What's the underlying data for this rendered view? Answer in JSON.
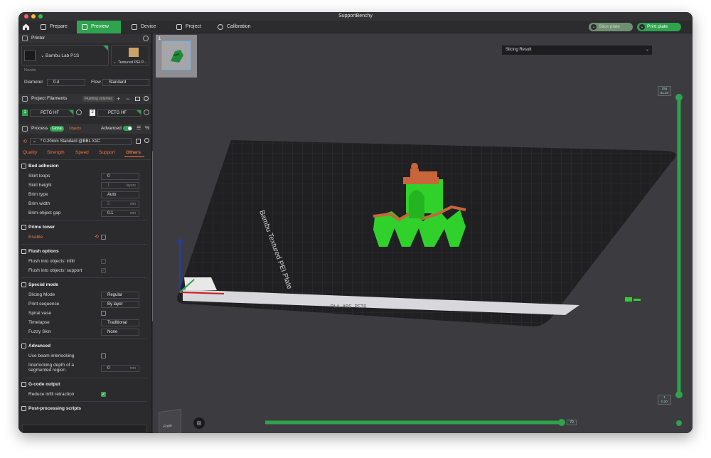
{
  "app": {
    "title": "SupportBenchy"
  },
  "colors": {
    "accent": "#2fa34e",
    "orange": "#e8763a",
    "model_green": "#2fd12a",
    "model_orange": "#c8653a"
  },
  "tabs": [
    {
      "label": "Prepare",
      "icon": "cube-icon"
    },
    {
      "label": "Preview",
      "icon": "layers-icon"
    },
    {
      "label": "Device",
      "icon": "device-icon"
    },
    {
      "label": "Project",
      "icon": "project-icon"
    },
    {
      "label": "Calibration",
      "icon": "calibration-icon"
    }
  ],
  "top_actions": {
    "slice": "Slice plate",
    "print": "Print plate"
  },
  "slicing_result": {
    "label": "Slicing Result"
  },
  "printer": {
    "header": "Printer",
    "name": "Bambu Lab P1S",
    "plate": "Textured PEI P...",
    "nozzle_label": "Nozzle",
    "diameter_label": "Diameter",
    "diameter_value": "0.4",
    "flow_label": "Flow",
    "flow_value": "Standard"
  },
  "filaments": {
    "header": "Project Filaments",
    "flushing": "Flushing volumes",
    "items": [
      {
        "index": "1",
        "name": "PETG HF"
      },
      {
        "index": "2",
        "name": "PETG HF"
      }
    ]
  },
  "process": {
    "header": "Process",
    "global": "Global",
    "objects": "Objects",
    "advanced": "Advanced",
    "preset": "* 0.20mm Standard @BBL X1C"
  },
  "process_tabs": [
    "Quality",
    "Strength",
    "Speed",
    "Support",
    "Others"
  ],
  "sections": {
    "bed_adhesion": {
      "title": "Bed adhesion",
      "rows": [
        {
          "label": "Skirt loops",
          "value": "0",
          "unit": ""
        },
        {
          "label": "Skirt height",
          "value": "1",
          "unit": "layers"
        },
        {
          "label": "Brim type",
          "value": "Auto",
          "unit": ""
        },
        {
          "label": "Brim width",
          "value": "5",
          "unit": "mm"
        },
        {
          "label": "Brim-object gap",
          "value": "0.1",
          "unit": "mm"
        }
      ]
    },
    "prime_tower": {
      "title": "Prime tower",
      "enable": "Enable"
    },
    "flush": {
      "title": "Flush options",
      "infill": "Flush into objects' infill",
      "support": "Flush into objects' support"
    },
    "special": {
      "title": "Special mode",
      "rows": [
        {
          "label": "Slicing Mode",
          "value": "Regular"
        },
        {
          "label": "Print sequence",
          "value": "By layer"
        },
        {
          "label": "Spiral vase",
          "value": ""
        },
        {
          "label": "Timelapse",
          "value": "Traditional"
        },
        {
          "label": "Fuzzy Skin",
          "value": "None"
        }
      ]
    },
    "advanced": {
      "title": "Advanced",
      "beam": "Use beam interlocking",
      "depth_label": "Interlocking depth of a segmented region",
      "depth_value": "0",
      "depth_unit": "mm"
    },
    "gcode": {
      "title": "G-code output",
      "reduce": "Reduce infill retraction"
    },
    "post": {
      "title": "Post-processing scripts"
    }
  },
  "viewport": {
    "plate_num": "1",
    "plate_text": "Bambu Textured PEI Plate",
    "front_label": "Front",
    "layer_top": "256",
    "layer_top_h": "51.20",
    "layer_bottom": "1",
    "layer_bottom_h": "0.20",
    "move_value": "79",
    "strip_text": "PLA ABS PETG"
  }
}
